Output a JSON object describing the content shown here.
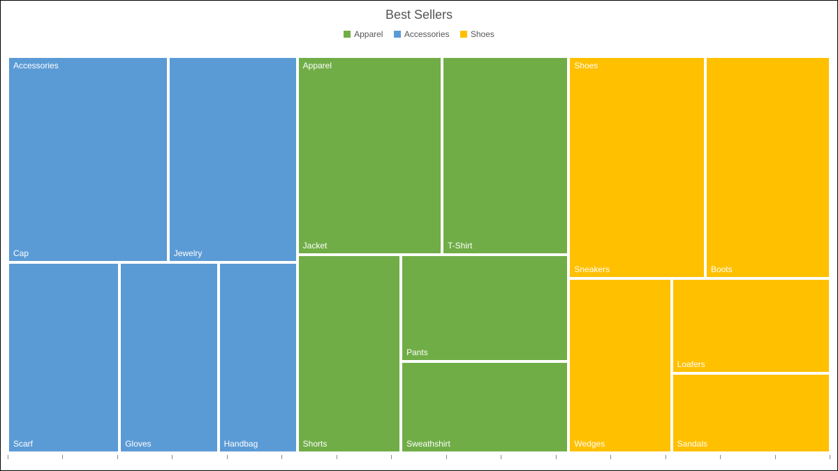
{
  "title": "Best Sellers",
  "legend": [
    {
      "label": "Apparel",
      "color": "#70AD47"
    },
    {
      "label": "Accessories",
      "color": "#5B9BD5"
    },
    {
      "label": "Shoes",
      "color": "#FFC000"
    }
  ],
  "chart_data": {
    "type": "treemap",
    "title": "Best Sellers",
    "series": [
      {
        "name": "Accessories",
        "color": "#5B9BD5",
        "items": [
          {
            "name": "Cap",
            "value": 130
          },
          {
            "name": "Jewelry",
            "value": 105
          },
          {
            "name": "Scarf",
            "value": 85
          },
          {
            "name": "Gloves",
            "value": 75
          },
          {
            "name": "Handbag",
            "value": 60
          }
        ]
      },
      {
        "name": "Apparel",
        "color": "#70AD47",
        "items": [
          {
            "name": "Jacket",
            "value": 115
          },
          {
            "name": "T-Shirt",
            "value": 100
          },
          {
            "name": "Shorts",
            "value": 80
          },
          {
            "name": "Pants",
            "value": 70
          },
          {
            "name": "Sweathshirt",
            "value": 60
          }
        ]
      },
      {
        "name": "Shoes",
        "color": "#FFC000",
        "items": [
          {
            "name": "Sneakers",
            "value": 120
          },
          {
            "name": "Boots",
            "value": 110
          },
          {
            "name": "Wedges",
            "value": 80
          },
          {
            "name": "Loafers",
            "value": 55
          },
          {
            "name": "Sandals",
            "value": 45
          }
        ]
      }
    ]
  },
  "layout": {
    "cells": [
      {
        "cls": "c-acc",
        "grp": "Accessories",
        "lbl": "Cap",
        "l": 0,
        "t": 0,
        "w": 19.5,
        "h": 52
      },
      {
        "cls": "c-acc",
        "grp": "",
        "lbl": "Jewelry",
        "l": 19.5,
        "t": 0,
        "w": 15.7,
        "h": 52
      },
      {
        "cls": "c-acc",
        "grp": "",
        "lbl": "Scarf",
        "l": 0,
        "t": 52,
        "w": 13.6,
        "h": 48
      },
      {
        "cls": "c-acc",
        "grp": "",
        "lbl": "Gloves",
        "l": 13.6,
        "t": 52,
        "w": 12.0,
        "h": 48
      },
      {
        "cls": "c-acc",
        "grp": "",
        "lbl": "Handbag",
        "l": 25.6,
        "t": 52,
        "w": 9.6,
        "h": 48
      },
      {
        "cls": "c-app",
        "grp": "Apparel",
        "lbl": "Jacket",
        "l": 35.2,
        "t": 0,
        "w": 17.6,
        "h": 50
      },
      {
        "cls": "c-app",
        "grp": "",
        "lbl": "T-Shirt",
        "l": 52.8,
        "t": 0,
        "w": 15.4,
        "h": 50
      },
      {
        "cls": "c-app",
        "grp": "",
        "lbl": "Shorts",
        "l": 35.2,
        "t": 50,
        "w": 12.6,
        "h": 50
      },
      {
        "cls": "c-app",
        "grp": "",
        "lbl": "Pants",
        "l": 47.8,
        "t": 50,
        "w": 20.4,
        "h": 27
      },
      {
        "cls": "c-app",
        "grp": "",
        "lbl": "Sweathshirt",
        "l": 47.8,
        "t": 77,
        "w": 20.4,
        "h": 23
      },
      {
        "cls": "c-sho",
        "grp": "Shoes",
        "lbl": "Sneakers",
        "l": 68.2,
        "t": 0,
        "w": 16.6,
        "h": 56
      },
      {
        "cls": "c-sho",
        "grp": "",
        "lbl": "Boots",
        "l": 84.8,
        "t": 0,
        "w": 15.2,
        "h": 56
      },
      {
        "cls": "c-sho",
        "grp": "",
        "lbl": "Wedges",
        "l": 68.2,
        "t": 56,
        "w": 12.5,
        "h": 44
      },
      {
        "cls": "c-sho",
        "grp": "",
        "lbl": "Loafers",
        "l": 80.7,
        "t": 56,
        "w": 19.3,
        "h": 24
      },
      {
        "cls": "c-sho",
        "grp": "",
        "lbl": "Sandals",
        "l": 80.7,
        "t": 80,
        "w": 19.3,
        "h": 20
      }
    ]
  }
}
